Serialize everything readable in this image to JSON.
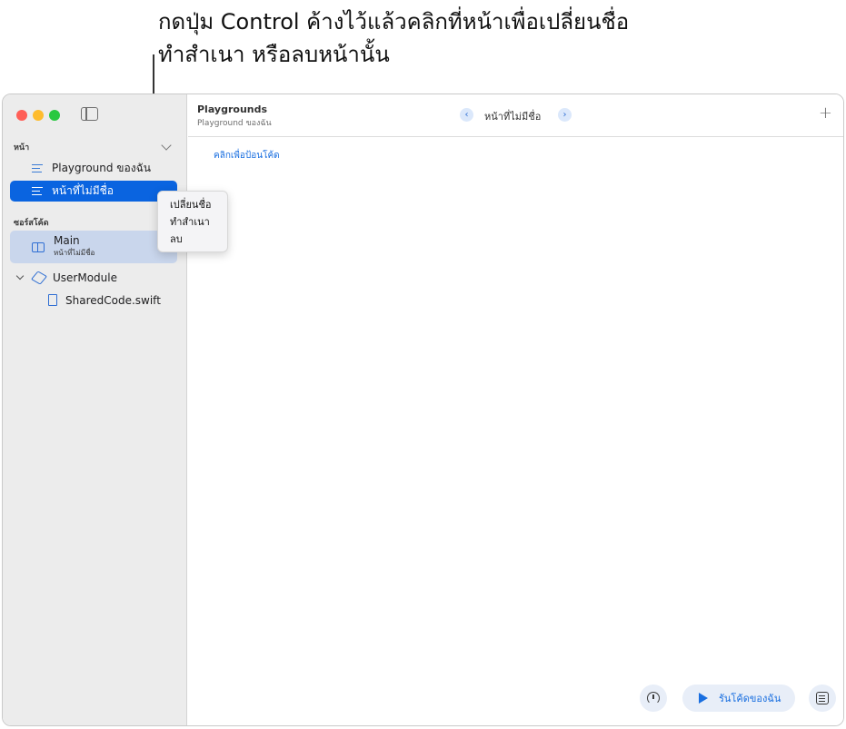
{
  "callout": {
    "line1": "กดปุ่ม Control ค้างไว้แล้วคลิกที่หน้าเพื่อเปลี่ยนชื่อ",
    "line2": "ทำสำเนา หรือลบหน้านั้น"
  },
  "sidebar": {
    "pages_header": "หน้า",
    "pages": [
      {
        "label": "Playground ของฉัน",
        "icon": "lines-icon"
      },
      {
        "label": "หน้าที่ไม่มีชื่อ",
        "icon": "lines-icon",
        "selected": true
      }
    ],
    "source_header": "ซอร์สโค้ด",
    "main_item": {
      "label": "Main",
      "sublabel": "หน้าที่ไม่มีชื่อ",
      "icon": "book-icon"
    },
    "module": {
      "label": "UserModule",
      "icon": "cube-icon"
    },
    "file": {
      "label": "SharedCode.swift",
      "icon": "file-icon"
    }
  },
  "context_menu": {
    "items": [
      "เปลี่ยนชื่อ",
      "ทำสำเนา",
      "ลบ"
    ]
  },
  "toolbar": {
    "title": "Playgrounds",
    "subtitle": "Playground ของฉัน",
    "page_name": "หน้าที่ไม่มีชื่อ",
    "back_glyph": "‹",
    "forward_glyph": "›",
    "add_glyph": "+"
  },
  "editor": {
    "placeholder": "คลิกเพื่อป้อนโค้ด",
    "run_label": "รันโค้ดของฉัน"
  },
  "colors": {
    "accent": "#0a64e0",
    "selection_bg": "#0a64e0",
    "highlight_bg": "#c9d6ec",
    "sidebar_bg": "#ececec"
  }
}
